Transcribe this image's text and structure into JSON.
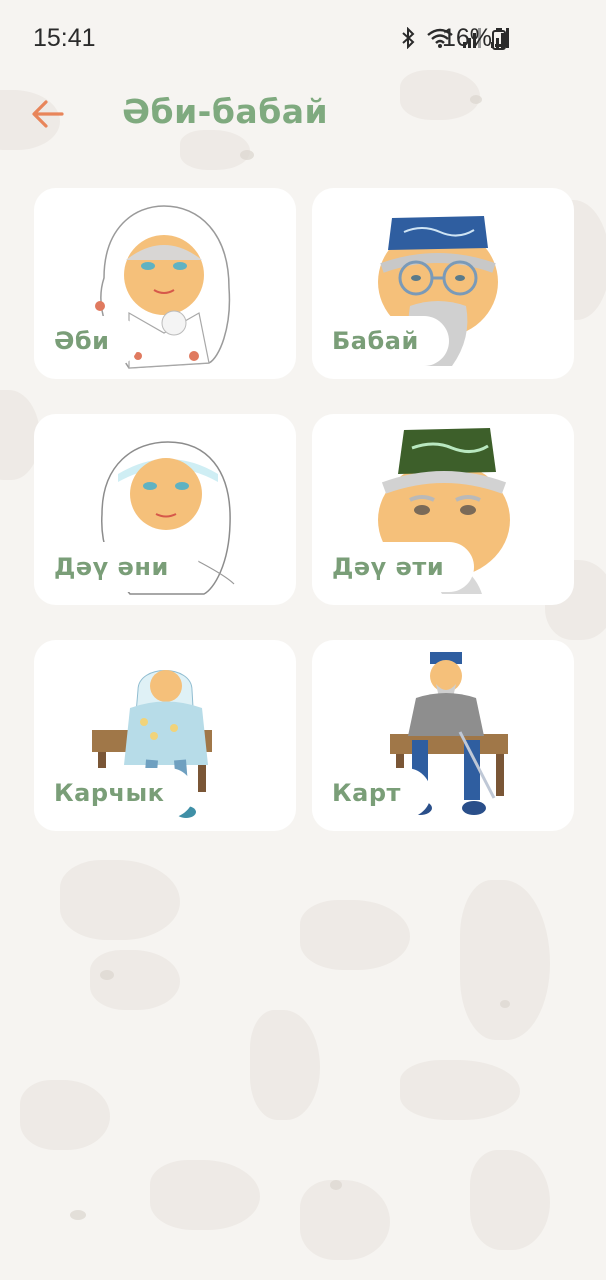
{
  "status_bar": {
    "time": "15:41",
    "battery": "16%",
    "icons": [
      "bluetooth-icon",
      "wifi-icon",
      "signal-icon",
      "signal-icon-2",
      "battery-icon"
    ]
  },
  "header": {
    "title": "Әби-бабай",
    "back_icon": "arrow-left-icon",
    "accent_color": "#e8855a",
    "title_color": "#7faa7f"
  },
  "cards": [
    {
      "label": "Әби",
      "image": "grandmother-white-scarf"
    },
    {
      "label": "Бабай",
      "image": "grandfather-blue-skullcap"
    },
    {
      "label": "Дәү әни",
      "image": "great-grandmother"
    },
    {
      "label": "Дәү әти",
      "image": "great-grandfather-green-skullcap"
    },
    {
      "label": "Карчык",
      "image": "old-woman-on-bench"
    },
    {
      "label": "Карт",
      "image": "old-man-on-bench"
    }
  ]
}
